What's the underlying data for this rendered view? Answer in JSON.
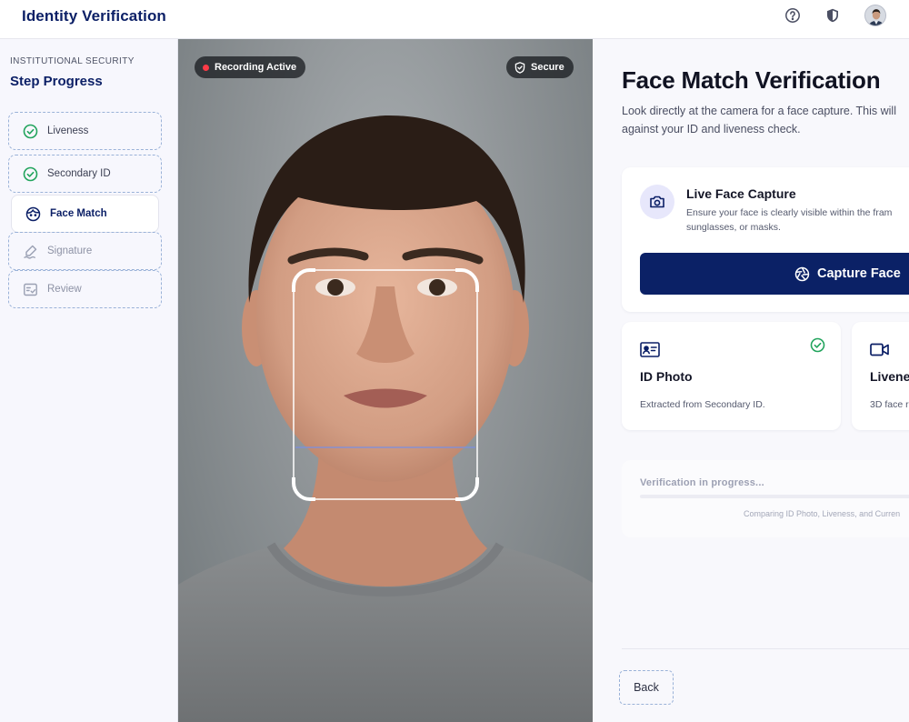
{
  "header": {
    "title": "Identity Verification",
    "icons": [
      "help-icon",
      "shield-icon",
      "avatar"
    ]
  },
  "sidebar": {
    "eyebrow": "INSTITUTIONAL SECURITY",
    "title": "Step Progress",
    "steps": [
      {
        "label": "Liveness",
        "state": "complete",
        "icon": "check-circle-icon"
      },
      {
        "label": "Secondary ID",
        "state": "complete",
        "icon": "check-circle-icon"
      },
      {
        "label": "Face Match",
        "state": "active",
        "icon": "face-icon"
      },
      {
        "label": "Signature",
        "state": "pending",
        "icon": "signature-icon"
      },
      {
        "label": "Review",
        "state": "pending",
        "icon": "review-icon"
      }
    ]
  },
  "camera": {
    "recording_label": "Recording Active",
    "secure_label": "Secure"
  },
  "main": {
    "title": "Face Match Verification",
    "description_line1": "Look directly at the camera for a face capture. This will",
    "description_line2": "against your ID and liveness check.",
    "capture_card": {
      "title": "Live Face Capture",
      "description": "Ensure your face is clearly visible within the fram sunglasses, or masks.",
      "button_label": "Capture Face"
    },
    "id_photo_card": {
      "title": "ID Photo",
      "description": "Extracted from Secondary ID."
    },
    "liveness_card": {
      "title": "Livene",
      "description": "3D face r"
    },
    "progress": {
      "label": "Verification in progress...",
      "note": "Comparing ID Photo, Liveness, and Curren",
      "percent": 0
    },
    "back_label": "Back"
  },
  "colors": {
    "brand": "#0b1f66",
    "primary_button": "#0b2166",
    "success": "#22a45d",
    "recording": "#ff3b47",
    "dashed_border": "#9ab2d8"
  }
}
